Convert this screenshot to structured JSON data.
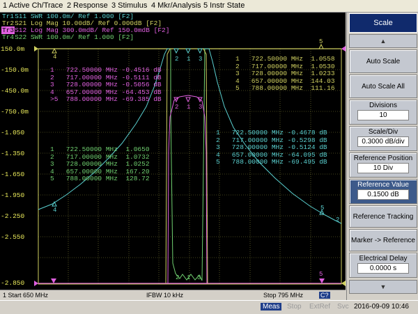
{
  "menu": [
    "1 Active Ch/Trace",
    "2 Response",
    "3 Stimulus",
    "4 Mkr/Analysis",
    "5 Instr State"
  ],
  "traces": [
    {
      "id": "Tr1",
      "label": "S11  SWR 100.0m/ Ref 1.000  [F2]",
      "color": "#5ad0d0"
    },
    {
      "id": "Tr2",
      "label": "S21  Log Mag 10.00dB/ Ref 0.000dB [F2]",
      "color": "#d0d060"
    },
    {
      "id": "Tr3",
      "label": "S12  Log Mag 300.0mdB/ Ref 150.0mdB [F2]",
      "color": "#e060e0"
    },
    {
      "id": "Tr4",
      "label": "S22  SWR 100.0m/ Ref 1.000  [F2]",
      "color": "#70d070"
    }
  ],
  "y_axis_labels": [
    "150.0m",
    "-150.0m",
    "-450.0m",
    "-750.0m",
    "-1.050",
    "-1.350",
    "-1.650",
    "-1.950",
    "-2.250",
    "-2.550",
    "-2.850"
  ],
  "marker_tables": {
    "tr1": [
      "1   722.50000 MHz  1.0558",
      "2   717.00000 MHz  1.0530",
      "3   728.00000 MHz  1.0233",
      "4   657.00000 MHz  144.03",
      "5   788.00000 MHz  111.16"
    ],
    "tr3": [
      "1   722.50000 MHz -0.4516 dB",
      "2   717.00000 MHz -0.5111 dB",
      "3   728.00000 MHz -0.5056 dB",
      "4   657.00000 MHz -64.453 dB",
      ">5  788.00000 MHz -69.385 dB"
    ],
    "tr2": [
      "1   722.50000 MHz -0.4678 dB",
      "2   717.00000 MHz -0.5298 dB",
      "3   728.00000 MHz -0.5124 dB",
      "4   657.00000 MHz -64.095 dB",
      "5   788.00000 MHz -69.495 dB"
    ],
    "tr4": [
      "1   722.50000 MHz  1.0650",
      "2   717.00000 MHz  1.0732",
      "3   728.00000 MHz  1.0252",
      "4   657.00000 MHz  167.20",
      "5   788.00000 MHz  128.72"
    ]
  },
  "status": {
    "start": "1  Start 650 MHz",
    "ifbw": "IFBW 10 kHz",
    "stop": "Stop 795 MHz",
    "c": "C?"
  },
  "bottom": {
    "meas": "Meas",
    "stop": "Stop",
    "extref": "ExtRef",
    "svc": "Svc",
    "datetime": "2016-09-09 10:46"
  },
  "sidebar": {
    "title": "Scale",
    "auto_scale": "Auto Scale",
    "auto_scale_all": "Auto Scale All",
    "divisions_label": "Divisions",
    "divisions_value": "10",
    "scale_div_label": "Scale/Div",
    "scale_div_value": "0.3000 dB/div",
    "ref_pos_label": "Reference Position",
    "ref_pos_value": "10 Div",
    "ref_val_label": "Reference Value",
    "ref_val_value": "0.1500 dB",
    "ref_tracking": "Reference Tracking",
    "marker_ref": "Marker -> Reference",
    "elec_delay_label": "Electrical Delay",
    "elec_delay_value": "0.0000 s"
  }
}
